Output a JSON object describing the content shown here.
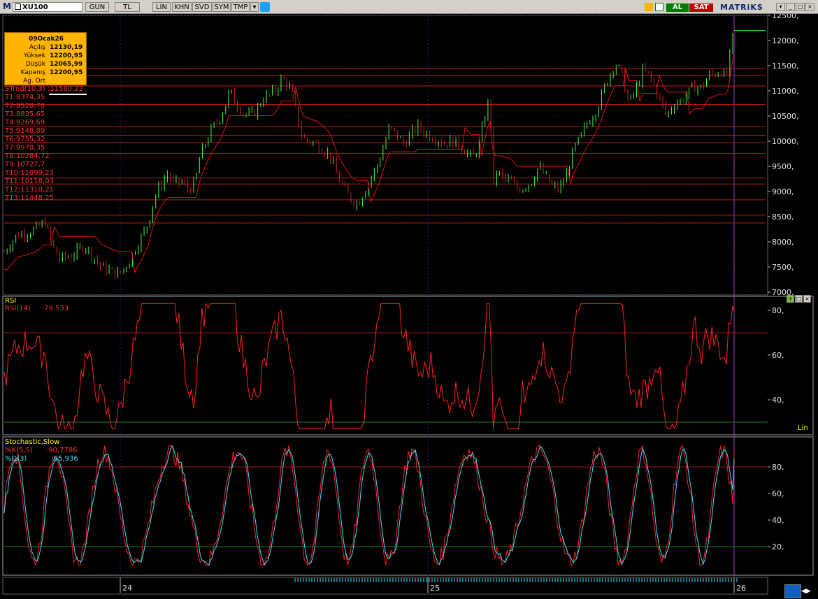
{
  "toolbar": {
    "logo": "M",
    "symbol": "XU100",
    "buttons": [
      {
        "label": "GUN"
      },
      {
        "label": "TL"
      },
      {
        "label": "LIN"
      },
      {
        "label": "KHN"
      },
      {
        "label": "SVD"
      },
      {
        "label": "SYM"
      },
      {
        "label": "TMP"
      }
    ],
    "buy_label": "AL",
    "sell_label": "SAT",
    "brand": "MATRiKS",
    "colors": {
      "bar": "#d4d0c8",
      "buy": "#007a00",
      "sell": "#c00000",
      "brand": "#0a246a"
    }
  },
  "info_box": {
    "date": "09Ocak26",
    "rows": [
      {
        "label": "Açılış",
        "value": "12130,19"
      },
      {
        "label": "Yüksek",
        "value": "12200,95"
      },
      {
        "label": "Düşük",
        "value": "12065,99"
      },
      {
        "label": "Kapanış",
        "value": "12200,95"
      },
      {
        "label": "Ağ. Ort",
        "value": ""
      }
    ]
  },
  "overlays": {
    "strend": {
      "label": "STrnd(10,3)",
      "value": ":11580,22"
    },
    "levels": [
      "T1:8374,35",
      "T2:8528,78",
      "T3:8835,65",
      "T4:9269,69",
      "T5:9148,89",
      "T6:9755,32",
      "T7:9970,35",
      "T8:10284,72",
      "T9:10727,7",
      "T10:11099,23",
      "T11:10118,03",
      "T12:11310,21",
      "T13:11448,25"
    ]
  },
  "rsi_panel": {
    "title": "RSI",
    "label": "RSI(14)",
    "value": ":79,533",
    "scale_mode": "Lin"
  },
  "stoch_panel": {
    "title": "Stochastic,Slow",
    "k_label": "%K(5,5)",
    "k_value": ":90,7786",
    "d_label": "%D(3)",
    "d_value": ":85,936"
  },
  "chart_data": [
    {
      "type": "line",
      "title": "XU100",
      "x_labels": [
        "24",
        "25",
        "26"
      ],
      "y_ticks": [
        "7000,",
        "7500,",
        "8000,",
        "8500,",
        "9000,",
        "9500,",
        "10000,",
        "10500,",
        "11000,",
        "11500,",
        "12000,",
        "12500,"
      ],
      "ylim": [
        7000,
        12500
      ],
      "series": [
        {
          "name": "STrnd(10,3)",
          "color": "#e01010"
        }
      ],
      "levels": [
        8374.35,
        8528.78,
        8835.65,
        9269.69,
        9148.89,
        9755.32,
        9970.35,
        10284.72,
        10727.7,
        11099.23,
        10118.03,
        11310.21,
        11448.25
      ],
      "x": [
        0,
        10,
        20,
        35,
        45,
        55,
        58,
        65,
        70,
        80,
        90,
        105,
        115,
        140,
        165,
        180,
        190,
        200,
        208,
        215,
        222,
        235,
        245,
        255,
        265,
        275,
        282,
        290,
        298,
        305,
        312,
        318,
        325,
        332,
        340,
        345,
        355,
        365,
        372,
        380,
        390,
        400,
        408,
        415,
        422,
        430,
        440,
        450,
        460,
        470,
        480,
        492,
        500,
        510,
        520,
        530,
        540,
        548,
        555,
        565,
        575,
        585,
        595,
        605,
        615,
        625,
        635,
        645,
        655,
        665,
        675,
        685,
        695,
        700,
        705,
        710,
        720,
        730,
        740,
        750,
        760,
        770,
        780,
        790,
        800,
        810,
        820,
        830,
        840,
        850,
        860,
        870,
        880,
        890,
        900,
        910,
        920,
        930,
        940,
        950,
        955,
        965,
        975,
        985,
        995,
        1005,
        1015,
        1025,
        1035,
        1040,
        1045,
        1048,
        1052
      ],
      "close": [
        7800,
        8000,
        8150,
        8200,
        8250,
        8350,
        8450,
        8100,
        7900,
        7650,
        7700,
        7800,
        7950,
        7500,
        7350,
        7600,
        7900,
        8150,
        8400,
        8800,
        9050,
        9350,
        9150,
        9200,
        9050,
        9150,
        9700,
        9950,
        10200,
        10350,
        10500,
        10700,
        11000,
        10800,
        10650,
        10550,
        10500,
        10650,
        10850,
        10900,
        11000,
        11250,
        11150,
        10950,
        10500,
        10050,
        10000,
        9950,
        9850,
        9700,
        9300,
        9000,
        8850,
        8750,
        9050,
        9300,
        9600,
        9950,
        10250,
        10150,
        9950,
        10100,
        10300,
        10200,
        10100,
        10050,
        9950,
        10000,
        9950,
        9800,
        9650,
        9950,
        10650,
        10850,
        9050,
        9400,
        9250,
        9200,
        9050,
        9100,
        9200,
        9500,
        9300,
        9100,
        9050,
        9300,
        9800,
        10050,
        10350,
        10550,
        10850,
        11250,
        11550,
        11350,
        10750,
        11000,
        11400,
        11300,
        11000,
        10650,
        10500,
        10750,
        10800,
        10950,
        11100,
        11050,
        11300,
        11350,
        11400,
        11200,
        11600,
        11900,
        12200
      ]
    },
    {
      "type": "line",
      "title": "RSI",
      "ylim": [
        25,
        85
      ],
      "y_ticks": [
        "40,",
        "60,",
        "80,"
      ],
      "series": [
        {
          "name": "RSI(14)",
          "color": "#ff2020"
        }
      ]
    },
    {
      "type": "line",
      "title": "Stochastic,Slow",
      "ylim": [
        0,
        100
      ],
      "y_ticks": [
        "20,",
        "40,",
        "60,",
        "80,"
      ],
      "series": [
        {
          "name": "%K(5,5)",
          "color": "#ff2020"
        },
        {
          "name": "%D(3)",
          "color": "#40e0ff"
        }
      ]
    }
  ]
}
